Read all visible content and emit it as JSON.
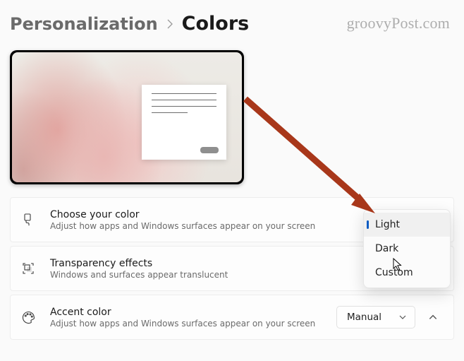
{
  "breadcrumb": {
    "parent": "Personalization",
    "current": "Colors"
  },
  "watermark": "groovyPost.com",
  "settings": {
    "color_mode": {
      "title": "Choose your color",
      "desc": "Adjust how apps and Windows surfaces appear on your screen"
    },
    "transparency": {
      "title": "Transparency effects",
      "desc": "Windows and surfaces appear translucent"
    },
    "accent": {
      "title": "Accent color",
      "desc": "Adjust how apps and Windows surfaces appear on your screen",
      "value": "Manual"
    }
  },
  "mode_menu": {
    "options": [
      "Light",
      "Dark",
      "Custom"
    ],
    "selected": "Light"
  }
}
